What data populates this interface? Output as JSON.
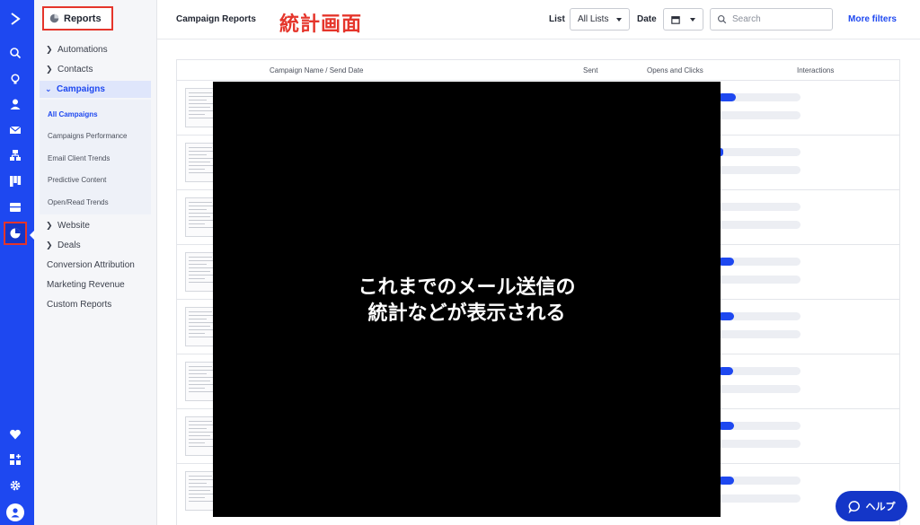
{
  "rail": {
    "icons": [
      "logo-icon",
      "search-icon",
      "lightbulb-icon",
      "contacts-icon",
      "email-icon",
      "automations-icon",
      "pipeline-icon",
      "inbox-icon",
      "reports-icon",
      "heart-icon",
      "apps-icon",
      "gear-icon",
      "user-avatar-icon"
    ]
  },
  "sidebar": {
    "title": "Reports",
    "items": [
      {
        "label": "Automations"
      },
      {
        "label": "Contacts"
      },
      {
        "label": "Campaigns"
      },
      {
        "label": "Website"
      },
      {
        "label": "Deals"
      },
      {
        "label": "Conversion Attribution"
      },
      {
        "label": "Marketing Revenue"
      },
      {
        "label": "Custom Reports"
      }
    ],
    "campaign_sub": [
      {
        "label": "All Campaigns"
      },
      {
        "label": "Campaigns Performance"
      },
      {
        "label": "Email Client Trends"
      },
      {
        "label": "Predictive Content"
      },
      {
        "label": "Open/Read Trends"
      }
    ]
  },
  "header": {
    "title": "Campaign Reports",
    "annotation": "統計画面",
    "list_label": "List",
    "list_value": "All Lists",
    "date_label": "Date",
    "search_placeholder": "Search",
    "more_filters": "More filters"
  },
  "table": {
    "columns": [
      "Campaign Name / Send Date",
      "Sent",
      "Opens and Clicks",
      "Interactions"
    ],
    "rows": [
      {
        "opens": 0.22,
        "clicks": 0.0
      },
      {
        "opens": 0.07,
        "clicks": 0.0
      },
      {
        "opens": 0.0,
        "clicks": 0.0
      },
      {
        "opens": 0.2,
        "clicks": 0.0
      },
      {
        "opens": 0.2,
        "clicks": 0.0
      },
      {
        "opens": 0.19,
        "clicks": 0.0
      },
      {
        "opens": 0.2,
        "clicks": 0.0
      },
      {
        "opens": 0.2,
        "clicks": 0.0
      }
    ]
  },
  "overlay": {
    "line1": "これまでのメール送信の",
    "line2": "統計などが表示される"
  },
  "help": {
    "label": "ヘルプ"
  },
  "colors": {
    "brand": "#1e48f0",
    "annotation": "#e5352b",
    "overlay": "#000000"
  }
}
